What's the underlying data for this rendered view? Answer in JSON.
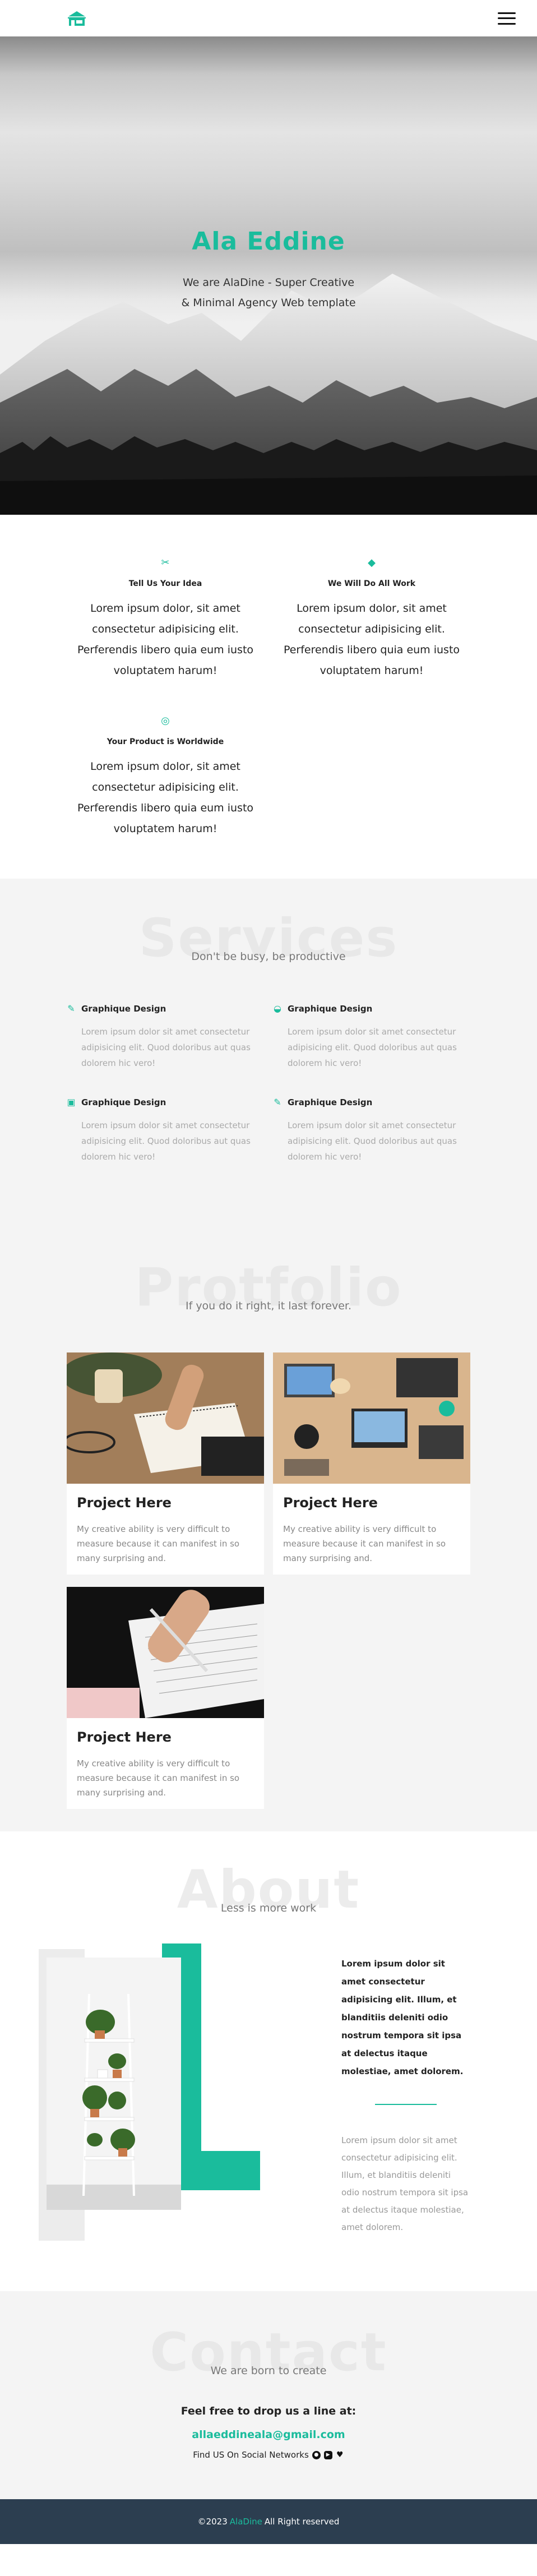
{
  "nav": {
    "logo_icon": "house-shop-icon",
    "menu_icon": "hamburger-icon"
  },
  "hero": {
    "title": "Ala Eddine",
    "subtitle_line1": "We are AlaDine - Super Creative",
    "subtitle_line2": "& Minimal Agency Web template"
  },
  "features": [
    {
      "icon": "magic-wand-icon",
      "title": "Tell Us Your Idea",
      "text": "Lorem ipsum dolor, sit amet consectetur adipisicing elit. Perferendis libero quia eum iusto voluptatem harum!"
    },
    {
      "icon": "diamond-icon",
      "title": "We Will Do All Work",
      "text": "Lorem ipsum dolor, sit amet consectetur adipisicing elit. Perferendis libero quia eum iusto voluptatem harum!"
    },
    {
      "icon": "globe-icon",
      "title": "Your Product is Worldwide",
      "text": "Lorem ipsum dolor, sit amet consectetur adipisicing elit. Perferendis libero quia eum iusto voluptatem harum!"
    }
  ],
  "services": {
    "big": "Services",
    "small": "Don't be busy, be productive",
    "items": [
      {
        "icon": "pencil-icon",
        "title": "Graphique Design",
        "text": "Lorem ipsum dolor sit amet consectetur adipisicing elit. Quod doloribus aut quas dolorem hic vero!"
      },
      {
        "icon": "ice-cream-icon",
        "title": "Graphique Design",
        "text": "Lorem ipsum dolor sit amet consectetur adipisicing elit. Quod doloribus aut quas dolorem hic vero!"
      },
      {
        "icon": "image-icon",
        "title": "Graphique Design",
        "text": "Lorem ipsum dolor sit amet consectetur adipisicing elit. Quod doloribus aut quas dolorem hic vero!"
      },
      {
        "icon": "pen-icon",
        "title": "Graphique Design",
        "text": "Lorem ipsum dolor sit amet consectetur adipisicing elit. Quod doloribus aut quas dolorem hic vero!"
      }
    ]
  },
  "portfolio": {
    "big": "Protfolio",
    "small": "If you do it right, it last forever.",
    "items": [
      {
        "title": "Project Here",
        "text": "My creative ability is very difficult to measure because it can manifest in so many surprising and."
      },
      {
        "title": "Project Here",
        "text": "My creative ability is very difficult to measure because it can manifest in so many surprising and."
      },
      {
        "title": "Project Here",
        "text": "My creative ability is very difficult to measure because it can manifest in so many surprising and."
      }
    ]
  },
  "about": {
    "big": "About",
    "small": "Less is more work",
    "strong": "Lorem ipsum dolor sit amet consectetur adipisicing elit. Illum, et blanditiis deleniti odio nostrum tempora sit ipsa at delectus itaque molestiae, amet dolorem.",
    "muted": "Lorem ipsum dolor sit amet consectetur adipisicing elit. Illum, et blanditiis deleniti odio nostrum tempora sit ipsa at delectus itaque molestiae, amet dolorem."
  },
  "contact": {
    "big": "Contact",
    "small": "We are born to create",
    "title": "Feel free to drop us a line at:",
    "email": "allaeddineala@gmail.com",
    "social_label": "Find US On Social Networks",
    "social_icons": [
      "github-icon",
      "youtube-icon",
      "twitter-icon"
    ]
  },
  "footer": {
    "prefix": "©2023",
    "brand": "AlaDine",
    "suffix": "All Right reserved"
  },
  "colors": {
    "accent": "#1abc9c",
    "footer_bg": "#2c3e50",
    "section_gray": "#f4f4f4"
  }
}
